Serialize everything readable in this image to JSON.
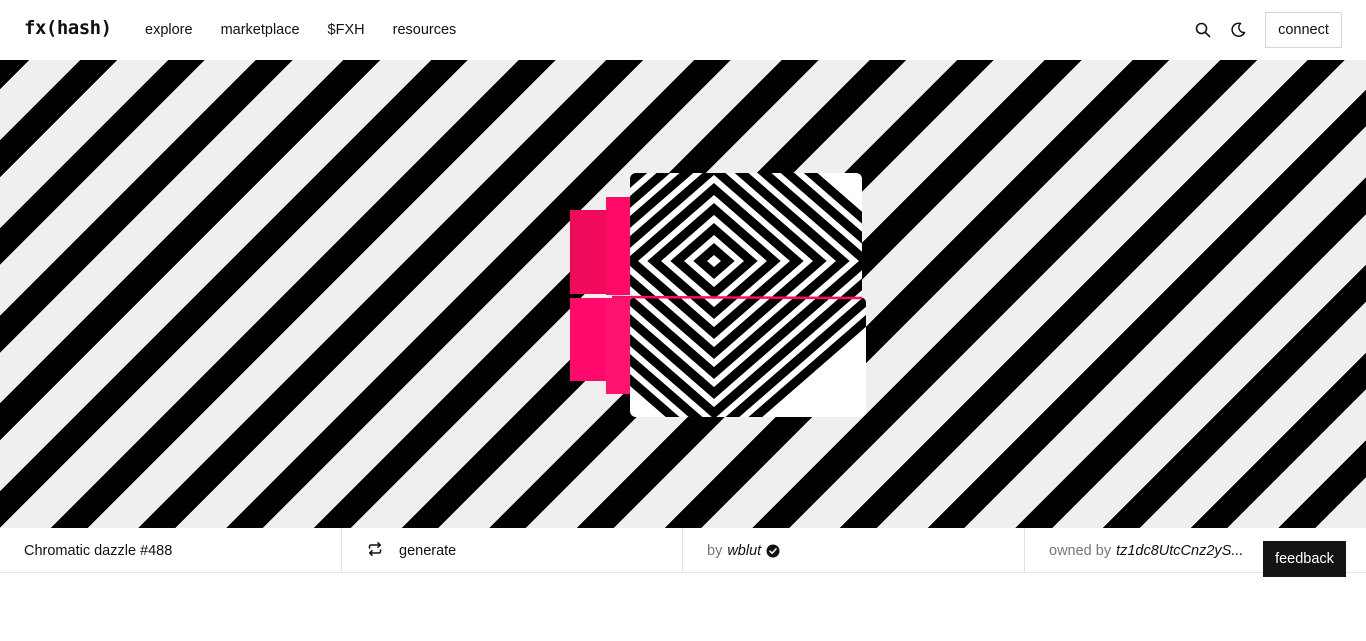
{
  "header": {
    "logo": "fx(hash)",
    "nav": [
      "explore",
      "marketplace",
      "$FXH",
      "resources"
    ],
    "search_icon": "search-icon",
    "theme_icon": "moon-icon",
    "connect_label": "connect"
  },
  "artwork": {
    "background": "diagonal black and light-grey stripes",
    "accent_color": "#ff0a66"
  },
  "info": {
    "title": "Chromatic dazzle #488",
    "generate_label": "generate",
    "generate_icon": "repeat-icon",
    "by_label": "by",
    "author": "wblut",
    "verified_icon": "verified-badge-icon",
    "owned_label": "owned by",
    "owner": "tz1dc8UtcCnz2yS..."
  },
  "feedback_label": "feedback"
}
